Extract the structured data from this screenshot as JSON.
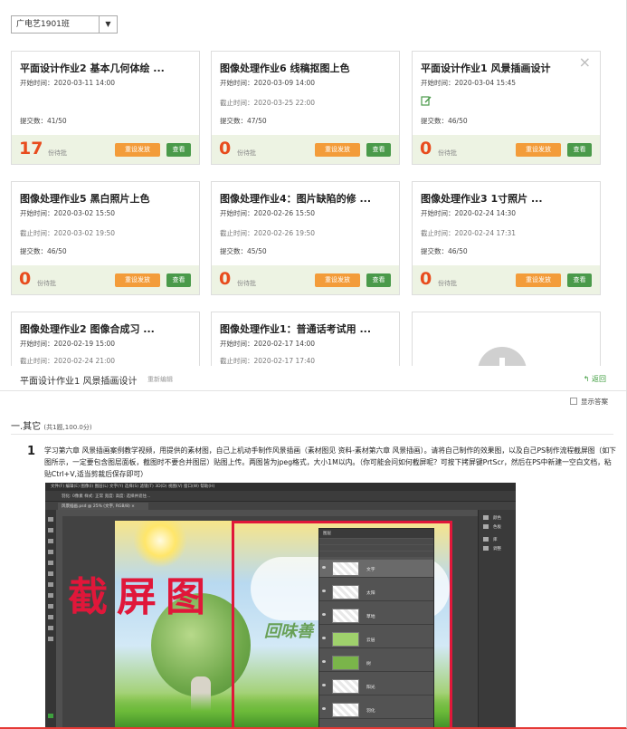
{
  "class_select": {
    "value": "广电艺1901班",
    "arrow": "▼"
  },
  "cards": [
    {
      "title": "平面设计作业2 基本几何体绘 ...",
      "start": "开始时间：2020-03-11 14:00",
      "deadline": "",
      "submit": "提交数：41/50",
      "count": "17",
      "count_label": "份待批",
      "reset_label": "重设发放",
      "view_label": "查看"
    },
    {
      "title": "图像处理作业6 线稿抠图上色",
      "start": "开始时间：2020-03-09 14:00",
      "deadline": "截止时间：2020-03-25 22:00",
      "submit": "提交数：47/50",
      "count": "0",
      "count_label": "份待批",
      "reset_label": "重设发放",
      "view_label": "查看"
    },
    {
      "title": "平面设计作业1 风景插画设计",
      "start": "开始时间：2020-03-04 15:45",
      "deadline": "",
      "submit": "提交数：46/50",
      "count": "0",
      "count_label": "份待批",
      "reset_label": "重设发放",
      "view_label": "查看",
      "close": "×"
    },
    {
      "title": "图像处理作业5 黑白照片上色",
      "start": "开始时间：2020-03-02 15:50",
      "deadline": "截止时间：2020-03-02 19:50",
      "submit": "提交数：46/50",
      "count": "0",
      "count_label": "份待批",
      "reset_label": "重设发放",
      "view_label": "查看"
    },
    {
      "title": "图像处理作业4：图片缺陷的修 ...",
      "start": "开始时间：2020-02-26 15:50",
      "deadline": "截止时间：2020-02-26 19:50",
      "submit": "提交数：45/50",
      "count": "0",
      "count_label": "份待批",
      "reset_label": "重设发放",
      "view_label": "查看"
    },
    {
      "title": "图像处理作业3 1寸照片 ...",
      "start": "开始时间：2020-02-24 14:30",
      "deadline": "截止时间：2020-02-24 17:31",
      "submit": "提交数：46/50",
      "count": "0",
      "count_label": "份待批",
      "reset_label": "重设发放",
      "view_label": "查看"
    },
    {
      "title": "图像处理作业2 图像合成习 ...",
      "start": "开始时间：2020-02-19 15:00",
      "deadline": "截止时间：2020-02-24 21:00"
    },
    {
      "title": "图像处理作业1：普通话考试用 ...",
      "start": "开始时间：2020-02-17 14:00",
      "deadline": "截止时间：2020-02-17 17:40"
    }
  ],
  "detail": {
    "title": "平面设计作业1 风景插画设计",
    "edit_label": "重新编辑",
    "back_label": "返回",
    "back_icon": "↰",
    "show_answer_label": "显示答案",
    "section_title": "一.其它",
    "section_sub": "(共1题,100.0分)",
    "question_number": "1",
    "question_text": "学习第六章 风景插画案例教学视频，用提供的素材图，自己上机动手制作风景插画（素材图见 资料-素材第六章 风景插画）。请将自己制作的效果图，以及自己PS制作流程截屏图（如下图所示，一定要包含图层面板，截图时不要合并图层）贴图上传。两图皆为jpeg格式，大小1M以内。（你可能会问如何截屏呢？可按下拷屏键PrtScr，然后在PS中新建一空白文档，粘贴Ctrl+V,适当剪裁后保存即可）"
  },
  "ps": {
    "menubar": "文件(F)  编辑(E)  图像(I)  图层(L)  文字(Y)  选择(S)  滤镜(T)  3D(D)  视图(V)  窗口(W)  帮助(H)",
    "options": "羽化: 0像素    样式: 正常    宽度:       高度:       选择并遮住...",
    "tab": "风景插画.psd @ 25% (文字, RGB/8) ×",
    "canvas_word": "回味善",
    "annotation": "截屏图",
    "layers_title": "图层",
    "layers": [
      "文字",
      "太阳",
      "草地",
      "云层",
      "树",
      "阳光",
      "羽化"
    ],
    "right_panel": [
      "颜色",
      "色板",
      "库",
      "调整"
    ]
  }
}
